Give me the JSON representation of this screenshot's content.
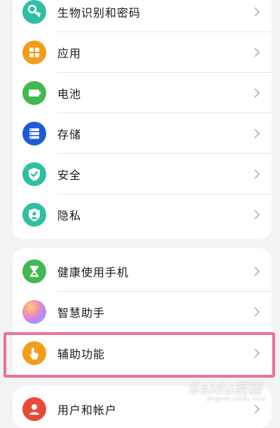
{
  "settings_group_1": [
    {
      "label": "生物识别和密码",
      "icon": "key-icon",
      "color": "#2fbfa3"
    },
    {
      "label": "应用",
      "icon": "apps-icon",
      "color": "#f39c1b"
    },
    {
      "label": "电池",
      "icon": "battery-icon",
      "color": "#3fb950"
    },
    {
      "label": "存储",
      "icon": "storage-icon",
      "color": "#1e5ad6"
    },
    {
      "label": "安全",
      "icon": "security-shield-icon",
      "color": "#2fbfa3"
    },
    {
      "label": "隐私",
      "icon": "privacy-shield-icon",
      "color": "#2fbfa3"
    }
  ],
  "settings_group_2": [
    {
      "label": "健康使用手机",
      "icon": "hourglass-icon",
      "color": "#3fb950"
    },
    {
      "label": "智慧助手",
      "icon": "smart-assistant-icon",
      "color": "#c98be8"
    },
    {
      "label": "辅助功能",
      "icon": "accessibility-hand-icon",
      "color": "#f39c1b"
    }
  ],
  "settings_group_3": [
    {
      "label": "用户和帐户",
      "icon": "user-icon",
      "color": "#e84a3a"
    }
  ],
  "highlight_color": "#ee6f98",
  "watermark": {
    "brand": "Baidu经验",
    "sub": "jingyan.baidu.com"
  }
}
